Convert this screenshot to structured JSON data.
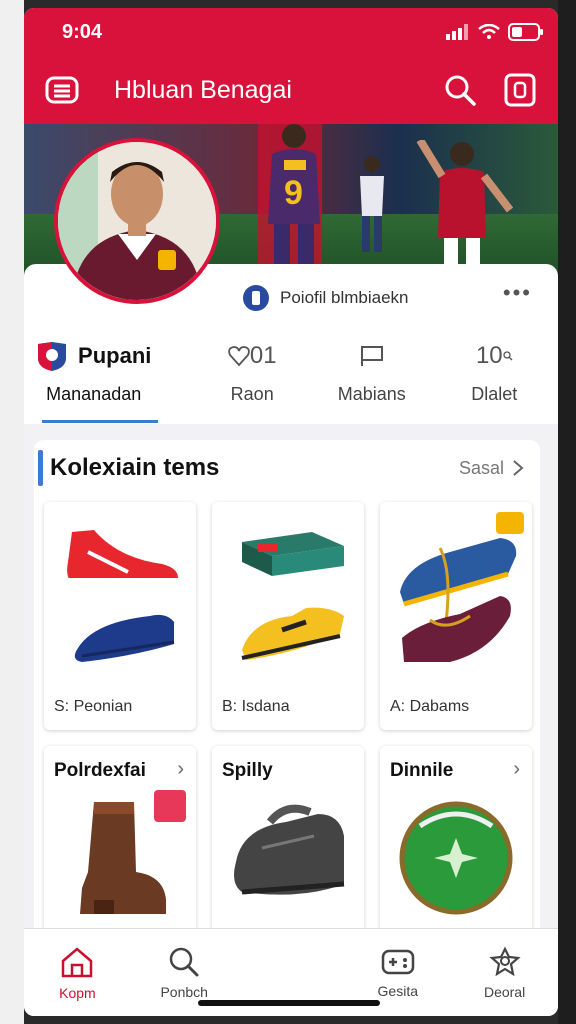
{
  "status": {
    "time": "9:04"
  },
  "appbar": {
    "title": "Hbluan Benagai"
  },
  "profile": {
    "subtitle": "Poiofil blmbiaekn",
    "team_name": "Pupani",
    "tabs": [
      {
        "top": "",
        "label": "Mananadan"
      },
      {
        "top": "01",
        "label": "Raon"
      },
      {
        "top": "",
        "label": "Mabians"
      },
      {
        "top": "10",
        "label": "Dlalet"
      }
    ]
  },
  "collection": {
    "title": "Kolexiain tems",
    "see_all": "Sasal",
    "items": [
      {
        "name": "S: Peonian"
      },
      {
        "name": "B: Isdana"
      },
      {
        "name": "A: Dabams"
      }
    ],
    "categories": [
      {
        "name": "Polrdexfai"
      },
      {
        "name": "Spilly"
      },
      {
        "name": "Dinnile"
      }
    ]
  },
  "bottom_nav": [
    {
      "label": "Kopm"
    },
    {
      "label": "Ponbch"
    },
    {
      "label": ""
    },
    {
      "label": "Gesita"
    },
    {
      "label": "Deoral"
    }
  ],
  "colors": {
    "brand": "#d8123a",
    "accent": "#3a7bd5"
  }
}
